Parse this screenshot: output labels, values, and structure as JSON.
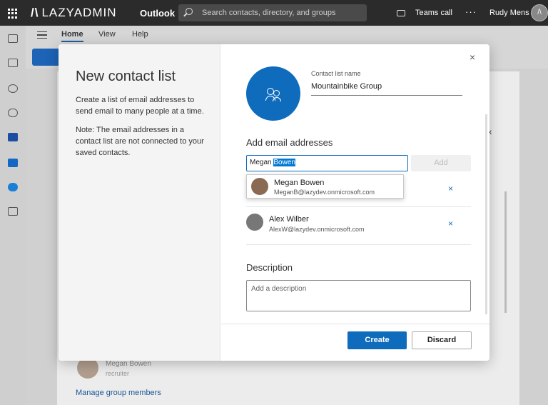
{
  "topbar": {
    "brand": "LAZYADMIN",
    "app_name": "Outlook",
    "search_placeholder": "Search contacts, directory, and groups",
    "teams_call": "Teams call",
    "more": "···",
    "user_name": "Rudy Mens"
  },
  "ribbon": {
    "tabs": [
      "Home",
      "View",
      "Help"
    ],
    "active_tab": "Home"
  },
  "background": {
    "member_name": "Megan Bowen",
    "member_role": "recruiter",
    "manage_link": "Manage group members"
  },
  "modal": {
    "title": "New contact list",
    "description": "Create a list of email addresses to send email to many people at a time.",
    "note": "Note: The email addresses in a contact list are not connected to your saved contacts.",
    "close": "×",
    "contact_list_name_label": "Contact list name",
    "contact_list_name_value": "Mountainbike Group",
    "add_email_heading": "Add email addresses",
    "email_input_typed": "Megan",
    "email_input_selected": "Bowen",
    "add_button": "Add",
    "suggestion": {
      "name": "Megan Bowen",
      "email": "MeganB@lazydev.onmicrosoft.com"
    },
    "members": [
      {
        "name": "",
        "email": "",
        "remove": "×"
      },
      {
        "name": "Alex Wilber",
        "email": "AlexW@lazydev.onmicrosoft.com",
        "remove": "×"
      }
    ],
    "description_heading": "Description",
    "description_placeholder": "Add a description",
    "create_button": "Create",
    "discard_button": "Discard"
  },
  "colors": {
    "accent": "#0f6cbd",
    "topbar": "#2b2b2b"
  }
}
